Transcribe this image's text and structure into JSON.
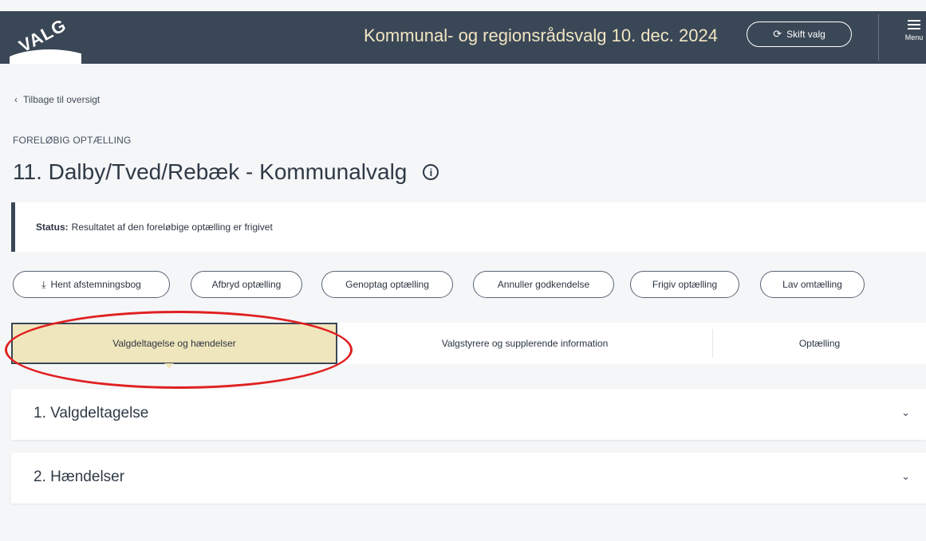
{
  "header": {
    "logo_text": "VALG",
    "title": "Kommunal- og regionsrådsvalg 10. dec. 2024",
    "switch_button": "Skift valg",
    "menu_label": "Menu",
    "colors": {
      "bar": "#3a4756",
      "title": "#f1e6c3"
    }
  },
  "nav": {
    "back_label": "Tilbage til oversigt"
  },
  "page": {
    "kicker": "FORELØBIG OPTÆLLING",
    "title": "11. Dalby/Tved/Rebæk - Kommunalvalg"
  },
  "status": {
    "label": "Status:",
    "text": "Resultatet af den foreløbige optælling er frigivet"
  },
  "actions": [
    {
      "label": "Hent afstemningsbog",
      "icon": "download-icon"
    },
    {
      "label": "Afbryd optælling"
    },
    {
      "label": "Genoptag optælling"
    },
    {
      "label": "Annuller godkendelse"
    },
    {
      "label": "Frigiv optælling"
    },
    {
      "label": "Lav omtælling"
    }
  ],
  "tabs": [
    {
      "label": "Valgdeltagelse og hændelser",
      "active": true
    },
    {
      "label": "Valgstyrere og supplerende information",
      "active": false
    },
    {
      "label": "Optælling",
      "active": false
    }
  ],
  "sections": [
    {
      "title": "1. Valgdeltagelse"
    },
    {
      "title": "2. Hændelser"
    }
  ],
  "accent_colors": {
    "active_tab": "#f0e6bd",
    "annotation": "#e02020"
  }
}
